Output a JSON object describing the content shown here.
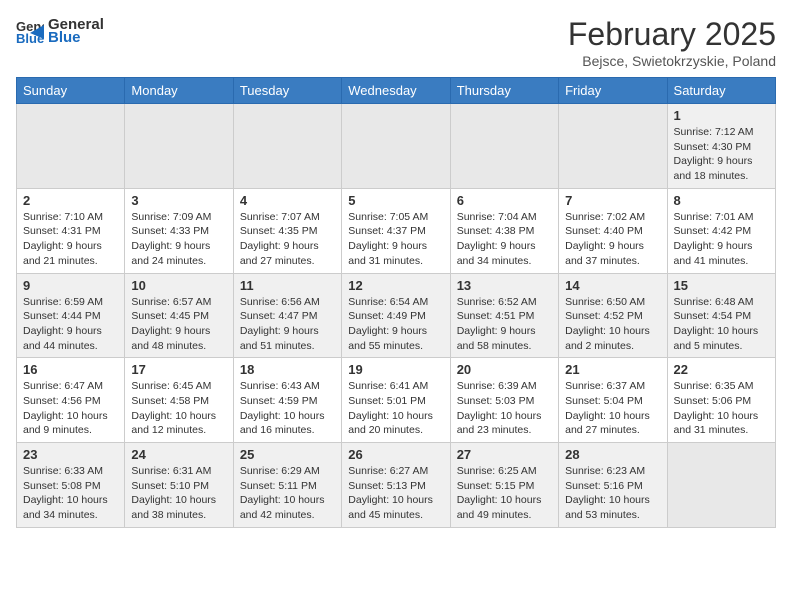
{
  "logo": {
    "general": "General",
    "blue": "Blue"
  },
  "title": "February 2025",
  "location": "Bejsce, Swietokrzyskie, Poland",
  "days_of_week": [
    "Sunday",
    "Monday",
    "Tuesday",
    "Wednesday",
    "Thursday",
    "Friday",
    "Saturday"
  ],
  "weeks": [
    [
      {
        "num": "",
        "info": ""
      },
      {
        "num": "",
        "info": ""
      },
      {
        "num": "",
        "info": ""
      },
      {
        "num": "",
        "info": ""
      },
      {
        "num": "",
        "info": ""
      },
      {
        "num": "",
        "info": ""
      },
      {
        "num": "1",
        "info": "Sunrise: 7:12 AM\nSunset: 4:30 PM\nDaylight: 9 hours and 18 minutes."
      }
    ],
    [
      {
        "num": "2",
        "info": "Sunrise: 7:10 AM\nSunset: 4:31 PM\nDaylight: 9 hours and 21 minutes."
      },
      {
        "num": "3",
        "info": "Sunrise: 7:09 AM\nSunset: 4:33 PM\nDaylight: 9 hours and 24 minutes."
      },
      {
        "num": "4",
        "info": "Sunrise: 7:07 AM\nSunset: 4:35 PM\nDaylight: 9 hours and 27 minutes."
      },
      {
        "num": "5",
        "info": "Sunrise: 7:05 AM\nSunset: 4:37 PM\nDaylight: 9 hours and 31 minutes."
      },
      {
        "num": "6",
        "info": "Sunrise: 7:04 AM\nSunset: 4:38 PM\nDaylight: 9 hours and 34 minutes."
      },
      {
        "num": "7",
        "info": "Sunrise: 7:02 AM\nSunset: 4:40 PM\nDaylight: 9 hours and 37 minutes."
      },
      {
        "num": "8",
        "info": "Sunrise: 7:01 AM\nSunset: 4:42 PM\nDaylight: 9 hours and 41 minutes."
      }
    ],
    [
      {
        "num": "9",
        "info": "Sunrise: 6:59 AM\nSunset: 4:44 PM\nDaylight: 9 hours and 44 minutes."
      },
      {
        "num": "10",
        "info": "Sunrise: 6:57 AM\nSunset: 4:45 PM\nDaylight: 9 hours and 48 minutes."
      },
      {
        "num": "11",
        "info": "Sunrise: 6:56 AM\nSunset: 4:47 PM\nDaylight: 9 hours and 51 minutes."
      },
      {
        "num": "12",
        "info": "Sunrise: 6:54 AM\nSunset: 4:49 PM\nDaylight: 9 hours and 55 minutes."
      },
      {
        "num": "13",
        "info": "Sunrise: 6:52 AM\nSunset: 4:51 PM\nDaylight: 9 hours and 58 minutes."
      },
      {
        "num": "14",
        "info": "Sunrise: 6:50 AM\nSunset: 4:52 PM\nDaylight: 10 hours and 2 minutes."
      },
      {
        "num": "15",
        "info": "Sunrise: 6:48 AM\nSunset: 4:54 PM\nDaylight: 10 hours and 5 minutes."
      }
    ],
    [
      {
        "num": "16",
        "info": "Sunrise: 6:47 AM\nSunset: 4:56 PM\nDaylight: 10 hours and 9 minutes."
      },
      {
        "num": "17",
        "info": "Sunrise: 6:45 AM\nSunset: 4:58 PM\nDaylight: 10 hours and 12 minutes."
      },
      {
        "num": "18",
        "info": "Sunrise: 6:43 AM\nSunset: 4:59 PM\nDaylight: 10 hours and 16 minutes."
      },
      {
        "num": "19",
        "info": "Sunrise: 6:41 AM\nSunset: 5:01 PM\nDaylight: 10 hours and 20 minutes."
      },
      {
        "num": "20",
        "info": "Sunrise: 6:39 AM\nSunset: 5:03 PM\nDaylight: 10 hours and 23 minutes."
      },
      {
        "num": "21",
        "info": "Sunrise: 6:37 AM\nSunset: 5:04 PM\nDaylight: 10 hours and 27 minutes."
      },
      {
        "num": "22",
        "info": "Sunrise: 6:35 AM\nSunset: 5:06 PM\nDaylight: 10 hours and 31 minutes."
      }
    ],
    [
      {
        "num": "23",
        "info": "Sunrise: 6:33 AM\nSunset: 5:08 PM\nDaylight: 10 hours and 34 minutes."
      },
      {
        "num": "24",
        "info": "Sunrise: 6:31 AM\nSunset: 5:10 PM\nDaylight: 10 hours and 38 minutes."
      },
      {
        "num": "25",
        "info": "Sunrise: 6:29 AM\nSunset: 5:11 PM\nDaylight: 10 hours and 42 minutes."
      },
      {
        "num": "26",
        "info": "Sunrise: 6:27 AM\nSunset: 5:13 PM\nDaylight: 10 hours and 45 minutes."
      },
      {
        "num": "27",
        "info": "Sunrise: 6:25 AM\nSunset: 5:15 PM\nDaylight: 10 hours and 49 minutes."
      },
      {
        "num": "28",
        "info": "Sunrise: 6:23 AM\nSunset: 5:16 PM\nDaylight: 10 hours and 53 minutes."
      },
      {
        "num": "",
        "info": ""
      }
    ]
  ]
}
